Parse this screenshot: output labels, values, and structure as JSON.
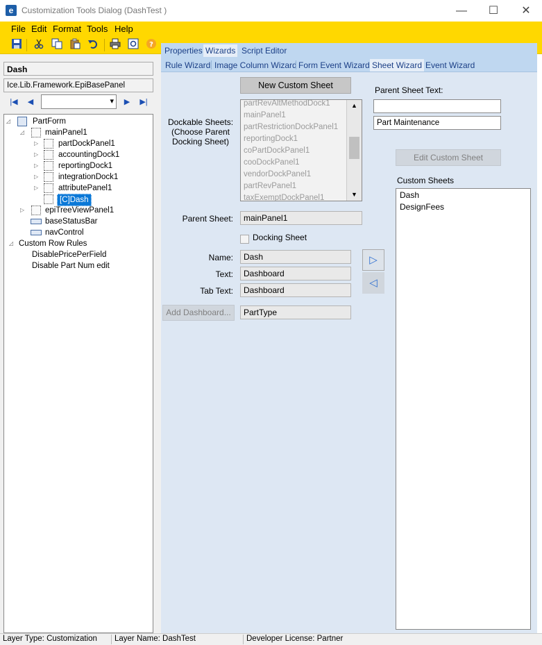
{
  "window": {
    "app_icon": "e",
    "title": "Customization Tools Dialog  (DashTest )",
    "minimize": "—",
    "maximize": "☐",
    "close": "✕"
  },
  "menu": [
    "File",
    "Edit",
    "Format",
    "Tools",
    "Help"
  ],
  "toolbar_icons": [
    "save-icon",
    "cut-icon",
    "copy-icon",
    "paste-icon",
    "undo-icon",
    "print-icon",
    "print-preview-icon",
    "help-icon"
  ],
  "left": {
    "selected_title": "Dash",
    "type_name": "Ice.Lib.Framework.EpiBasePanel",
    "nav_first": "|◀",
    "nav_prev": "◀",
    "nav_next": "▶",
    "nav_last": "▶|",
    "combo_arrow": "▾",
    "tree": [
      {
        "label": "PartForm",
        "level": 0,
        "expander": "◿"
      },
      {
        "label": "mainPanel1",
        "level": 1,
        "expander": "◿"
      },
      {
        "label": "partDockPanel1",
        "level": 2,
        "expander": "▷"
      },
      {
        "label": "accountingDock1",
        "level": 2,
        "expander": "▷"
      },
      {
        "label": "reportingDock1",
        "level": 2,
        "expander": "▷"
      },
      {
        "label": "integrationDock1",
        "level": 2,
        "expander": "▷"
      },
      {
        "label": "attributePanel1",
        "level": 2,
        "expander": "▷"
      },
      {
        "label": "[C]Dash",
        "level": 2,
        "expander": ""
      },
      {
        "label": "epiTreeViewPanel1",
        "level": 1,
        "expander": "▷"
      },
      {
        "label": "baseStatusBar",
        "level": 1,
        "expander": ""
      },
      {
        "label": "navControl",
        "level": 1,
        "expander": ""
      },
      {
        "label": "Custom Row Rules",
        "level": 0,
        "expander": "◿"
      },
      {
        "label": "DisablePricePerField",
        "level": 1,
        "expander": ""
      },
      {
        "label": "Disable Part Num edit",
        "level": 1,
        "expander": ""
      }
    ]
  },
  "tabs_row1": [
    "Properties",
    "Wizards",
    "Script Editor"
  ],
  "tabs_row2": [
    "Rule Wizard",
    "Image Column Wizard",
    "Form Event Wizard",
    "Sheet Wizard",
    "Event Wizard"
  ],
  "sheet": {
    "new_button": "New Custom Sheet",
    "dockable_label_1": "Dockable Sheets:",
    "dockable_label_2": "(Choose Parent",
    "dockable_label_3": "Docking Sheet)",
    "dockable_items": [
      "partRevAltMethodDock1",
      "mainPanel1",
      "partRestrictionDockPanel1",
      "reportingDock1",
      "coPartDockPanel1",
      "cooDockPanel1",
      "vendorDockPanel1",
      "partRevPanel1",
      "taxExemptDockPanel1"
    ],
    "scroll_up": "▲",
    "scroll_down": "▼",
    "parent_sheet_text_label": "Parent Sheet Text:",
    "parent_sheet_text_value": "",
    "parent_sheet_text_2": "Part Maintenance",
    "edit_button": "Edit Custom Sheet",
    "custom_sheets_label": "Custom Sheets",
    "custom_sheets": [
      "Dash",
      "DesignFees"
    ],
    "parent_sheet_label": "Parent Sheet:",
    "parent_sheet_value": "mainPanel1",
    "docking_label": "Docking Sheet",
    "name_label": "Name:",
    "name_value": "Dash",
    "text_label": "Text:",
    "text_value": "Dashboard",
    "tabtext_label": "Tab Text:",
    "tabtext_value": "Dashboard",
    "add_dashboard": "Add Dashboard...",
    "parttype_value": "PartType",
    "move_right": "▷",
    "move_left": "◁"
  },
  "status": {
    "layer_type": "Layer Type:  Customization",
    "layer_name": "Layer Name:  DashTest",
    "dev_license": "Developer License:  Partner"
  }
}
